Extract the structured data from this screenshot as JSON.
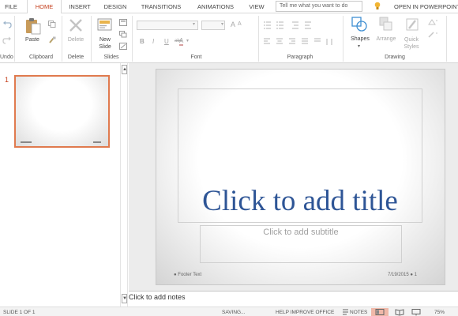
{
  "tabs": {
    "file": "FILE",
    "home": "HOME",
    "insert": "INSERT",
    "design": "DESIGN",
    "transitions": "TRANSITIONS",
    "animations": "ANIMATIONS",
    "view": "VIEW"
  },
  "tell_me": {
    "placeholder": "Tell me what you want to do"
  },
  "open_in": "OPEN IN POWERPOINT",
  "ribbon": {
    "undo": {
      "group_label": "Undo"
    },
    "clipboard": {
      "paste_label": "Paste",
      "group_label": "Clipboard"
    },
    "delete": {
      "delete_label": "Delete",
      "group_label": "Delete"
    },
    "slides": {
      "new_slide_label": "New Slide",
      "group_label": "Slides"
    },
    "font": {
      "bold": "B",
      "italic": "I",
      "underline": "U",
      "strike": "abc",
      "font_color": "A",
      "group_label": "Font"
    },
    "paragraph": {
      "group_label": "Paragraph"
    },
    "drawing": {
      "shapes_label": "Shapes",
      "arrange_label": "Arrange",
      "quick_styles_label": "Quick Styles",
      "group_label": "Drawing"
    }
  },
  "thumbnails": [
    {
      "number": "1"
    }
  ],
  "slide": {
    "title_placeholder": "Click to add title",
    "subtitle_placeholder": "Click to add subtitle",
    "footer": "Footer Text",
    "date": "7/19/2015",
    "page_number": "1"
  },
  "notes": {
    "placeholder": "Click to add notes"
  },
  "status_bar": {
    "slide_count": "SLIDE 1 OF 1",
    "saving": "SAVING...",
    "help_improve": "HELP IMPROVE OFFICE",
    "notes_label": "NOTES",
    "zoom": "75%"
  },
  "colors": {
    "accent": "#c43e1c",
    "title_text": "#2e5596",
    "thumb_border": "#e07a4e",
    "icon_blue": "#3f8fd2"
  },
  "icons": [
    "undo-icon",
    "redo-icon",
    "paste-icon",
    "delete-icon",
    "new-slide-icon",
    "shapes-icon",
    "arrange-icon",
    "quick-styles-icon",
    "lightbulb-icon",
    "notes-icon",
    "normal-view-icon",
    "reading-view-icon",
    "slideshow-icon"
  ]
}
